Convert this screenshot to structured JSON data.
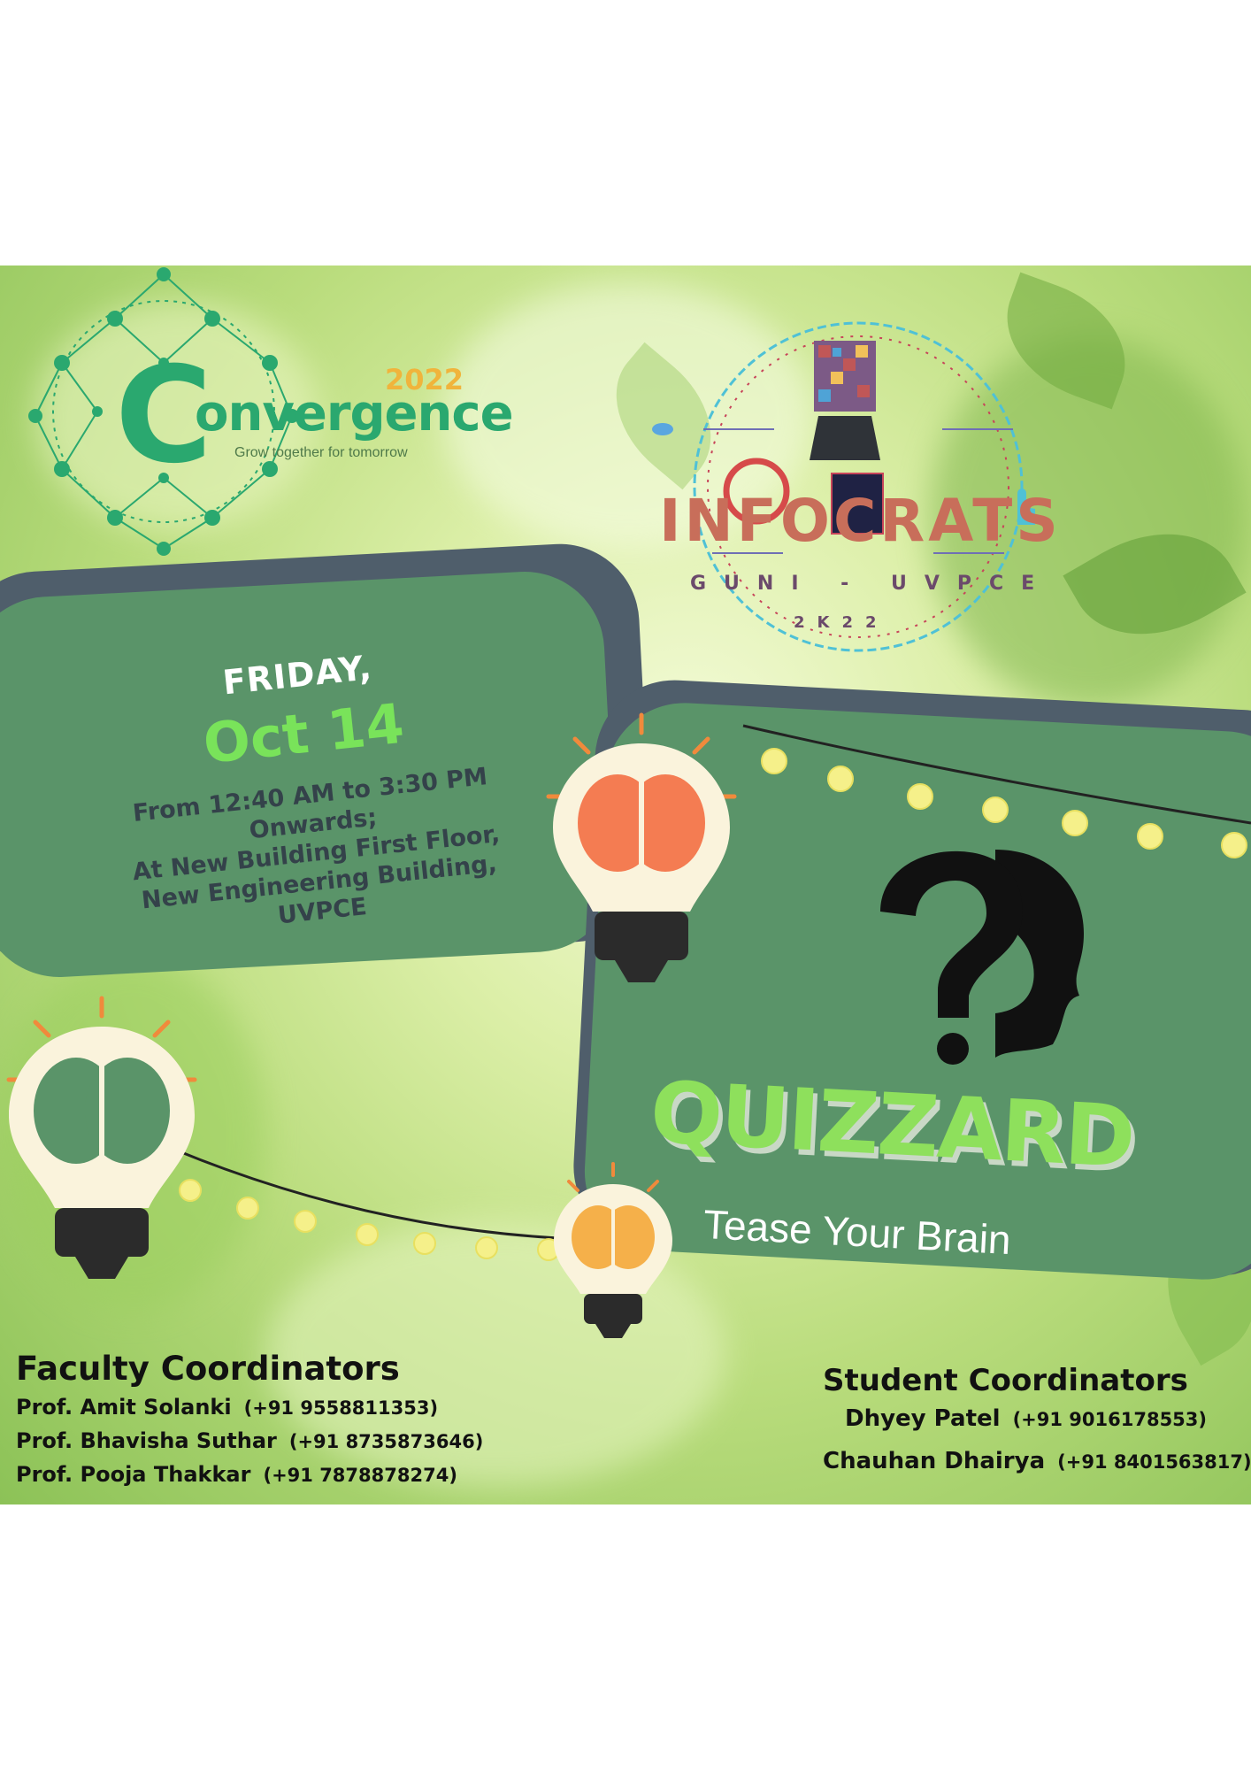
{
  "convergence_logo": {
    "year": "2022",
    "initial": "C",
    "word": "onvergence",
    "tagline": "Grow together for tomorrow",
    "colors": {
      "green": "#2aa86f",
      "orange": "#f0b43c"
    }
  },
  "infocrats_logo": {
    "name": "INFOCRATS",
    "subtitle": "GUNI - UVPCE",
    "year": "2K22"
  },
  "event": {
    "day": "FRIDAY,",
    "date": "Oct 14",
    "details": [
      "From 12:40 AM to 3:30 PM",
      "Onwards;",
      "At New Building First Floor,",
      "New Engineering Building,",
      "UVPCE"
    ]
  },
  "quiz": {
    "title": "QUIZZARD",
    "subtitle": "Tease Your Brain"
  },
  "faculty": {
    "heading": "Faculty Coordinators",
    "people": [
      {
        "name": "Prof. Amit Solanki",
        "phone": "(+91  9558811353)"
      },
      {
        "name": "Prof. Bhavisha Suthar",
        "phone": "(+91  8735873646)"
      },
      {
        "name": "Prof. Pooja Thakkar",
        "phone": "(+91  7878878274)"
      }
    ]
  },
  "students": {
    "heading": "Student Coordinators",
    "people": [
      {
        "name": "Dhyey Patel",
        "phone": "(+91  9016178553)"
      },
      {
        "name": "Chauhan Dhairya",
        "phone": "(+91  8401563817)"
      }
    ]
  },
  "colors": {
    "panel_green": "#5a9469",
    "panel_shadow": "#4f5e6b",
    "date_green": "#79e35a",
    "quiz_green": "#8ee05c"
  },
  "icons": [
    "network-icon",
    "lightbulb-brain-icon",
    "question-head-icon",
    "pointer-hand-icon",
    "cloud-icon"
  ]
}
